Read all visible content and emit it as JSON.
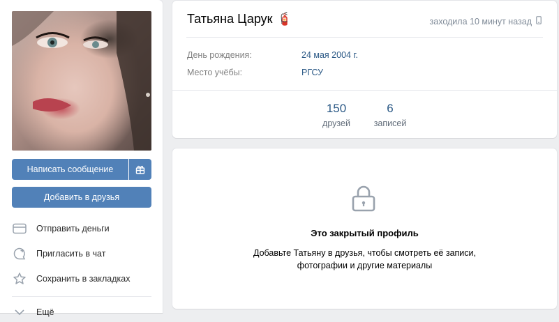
{
  "profile": {
    "name": "Татьяна Царук",
    "name_emoji": "🧯",
    "last_seen": "заходила 10 минут назад"
  },
  "info": [
    {
      "label": "День рождения:",
      "value": "24 мая 2004 г."
    },
    {
      "label": "Место учёбы:",
      "value": "РГСУ"
    }
  ],
  "stats": [
    {
      "value": "150",
      "label": "друзей"
    },
    {
      "value": "6",
      "label": "записей"
    }
  ],
  "actions": {
    "message": "Написать сообщение",
    "add_friend": "Добавить в друзья"
  },
  "side_actions": [
    {
      "label": "Отправить деньги",
      "icon": "card-icon"
    },
    {
      "label": "Пригласить в чат",
      "icon": "chat-plus-icon"
    },
    {
      "label": "Сохранить в закладках",
      "icon": "star-icon"
    },
    {
      "label": "Ещё",
      "icon": "chevron-down-icon"
    }
  ],
  "locked": {
    "title": "Это закрытый профиль",
    "line1": "Добавьте Татьяну в друзья, чтобы смотреть её записи,",
    "line2": "фотографии и другие материалы"
  },
  "colors": {
    "accent": "#5181b8",
    "link": "#2a5885",
    "muted": "#818c99",
    "background": "#edeef0"
  }
}
